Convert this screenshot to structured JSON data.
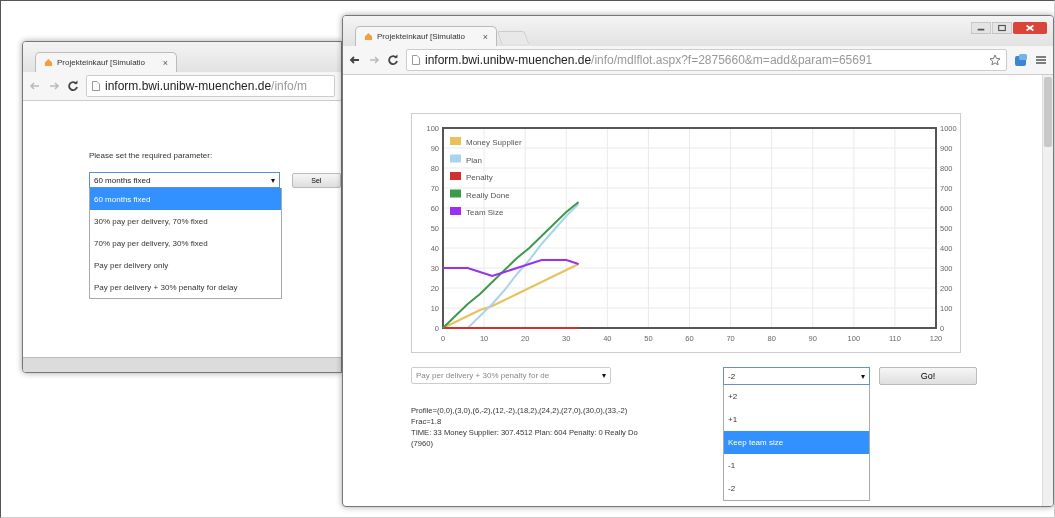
{
  "back_window": {
    "tab": {
      "title": "Projekteinkauf [Simulatio",
      "close": "×"
    },
    "address": {
      "host": "inform.bwi.unibw-muenchen.de",
      "path": "/info/m"
    },
    "prompt": "Please set the required parameter:",
    "select": {
      "value": "60 months fixed",
      "caret": "▾"
    },
    "button": "Sel",
    "options": [
      {
        "label": "60 months fixed",
        "selected": true
      },
      {
        "label": "30% pay per delivery, 70% fixed",
        "selected": false
      },
      {
        "label": "70% pay per delivery, 30% fixed",
        "selected": false
      },
      {
        "label": "Pay per delivery only",
        "selected": false
      },
      {
        "label": "Pay per delivery + 30% penalty for delay",
        "selected": false
      }
    ]
  },
  "front_window": {
    "tab": {
      "title": "Projekteinkauf [Simulatio",
      "close": "×"
    },
    "address": {
      "host": "inform.bwi.unibw-muenchen.de",
      "path": "/info/mdlflot.aspx?f=2875660&m=add&param=65691"
    },
    "chart": {
      "right_axis_labels": [
        "1000",
        "900",
        "800",
        "700",
        "600",
        "500",
        "400",
        "300",
        "200",
        "100",
        "0"
      ],
      "chart_data": {
        "type": "line",
        "grid": true,
        "legend": true,
        "x": [
          0,
          3,
          6,
          9,
          12,
          15,
          18,
          21,
          24,
          27,
          30,
          33
        ],
        "xlim": [
          0,
          120
        ],
        "ylim": [
          0,
          100
        ],
        "xticks": [
          0,
          10,
          20,
          30,
          40,
          50,
          60,
          70,
          80,
          90,
          100,
          110,
          120
        ],
        "yticks": [
          0,
          10,
          20,
          30,
          40,
          50,
          60,
          70,
          80,
          90,
          100
        ],
        "series": [
          {
            "name": "Money Supplier",
            "color": "#e8c15a",
            "values": [
              0,
              3,
              6,
              9,
              11,
              14,
              17,
              20,
              23,
              26,
              29,
              32
            ]
          },
          {
            "name": "Plan",
            "color": "#a9d3ef",
            "values": [
              0,
              0,
              0,
              6,
              12,
              19,
              27,
              34,
              42,
              49,
              56,
              62
            ]
          },
          {
            "name": "Penalty",
            "color": "#d03030",
            "values": [
              0,
              0,
              0,
              0,
              0,
              0,
              0,
              0,
              0,
              0,
              0,
              0
            ]
          },
          {
            "name": "Really Done",
            "color": "#3d9a4a",
            "values": [
              0,
              6,
              12,
              17,
              23,
              29,
              35,
              40,
              46,
              52,
              58,
              63
            ]
          },
          {
            "name": "Team Size",
            "color": "#9a30f0",
            "values": [
              30,
              30,
              30,
              28,
              26,
              28,
              30,
              32,
              34,
              34,
              34,
              32
            ]
          }
        ]
      }
    },
    "model_select": {
      "value": "Pay per delivery + 30% penalty for de",
      "caret": "▾",
      "disabled": true
    },
    "team_select": {
      "value": "-2",
      "caret": "▾"
    },
    "go_button": "Go!",
    "team_options": [
      {
        "label": "+2",
        "selected": false
      },
      {
        "label": "+1",
        "selected": false
      },
      {
        "label": "Keep team size",
        "selected": true
      },
      {
        "label": "-1",
        "selected": false
      },
      {
        "label": "-2",
        "selected": false
      }
    ],
    "output_lines": [
      "Profile=(0,0),(3,0),(6,-2),(12,-2),(18,2),(24,2),(27,0),(30,0),(33,-2)",
      "Frac=1.8",
      "TIME: 33 Money Supplier: 307.4512 Plan: 604 Penalty: 0 Really Do",
      "(7960)"
    ]
  }
}
